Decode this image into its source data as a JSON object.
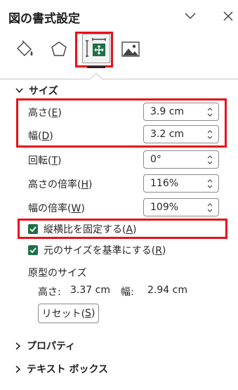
{
  "pane": {
    "title": "図の書式設定"
  },
  "icons": {
    "collapse": "chevron-down-icon",
    "close": "close-icon",
    "fill_line": "fill-bucket-icon",
    "effects": "pentagon-icon",
    "size_properties": "size-properties-icon",
    "picture": "picture-icon"
  },
  "colors": {
    "highlight": "#e8101a",
    "checkbox": "#1e7145"
  },
  "size_section": {
    "title": "サイズ",
    "height": {
      "label": "高さ(",
      "accel": "E",
      "close": ")",
      "value": "3.9 cm"
    },
    "width": {
      "label": "幅(",
      "accel": "D",
      "close": ")",
      "value": "3.2 cm"
    },
    "rotation": {
      "label": "回転(",
      "accel": "T",
      "close": ")",
      "value": "0°"
    },
    "scale_height": {
      "label": "高さの倍率(",
      "accel": "H",
      "close": ")",
      "value": "116%"
    },
    "scale_width": {
      "label": "幅の倍率(",
      "accel": "W",
      "close": ")",
      "value": "109%"
    },
    "lock_aspect": {
      "label": "縦横比を固定する(",
      "accel": "A",
      "close": ")",
      "checked": true
    },
    "relative_original": {
      "label": "元のサイズを基準にする(",
      "accel": "R",
      "close": ")",
      "checked": true
    },
    "original_size": {
      "title": "原型のサイズ",
      "height_label": "高さ:",
      "height_value": "3.37 cm",
      "width_label": "幅:",
      "width_value": "2.94 cm"
    },
    "reset": {
      "label": "リセット(",
      "accel": "S",
      "close": ")"
    }
  },
  "properties_section": {
    "title": "プロパティ"
  },
  "textbox_section": {
    "title": "テキスト ボックス"
  }
}
